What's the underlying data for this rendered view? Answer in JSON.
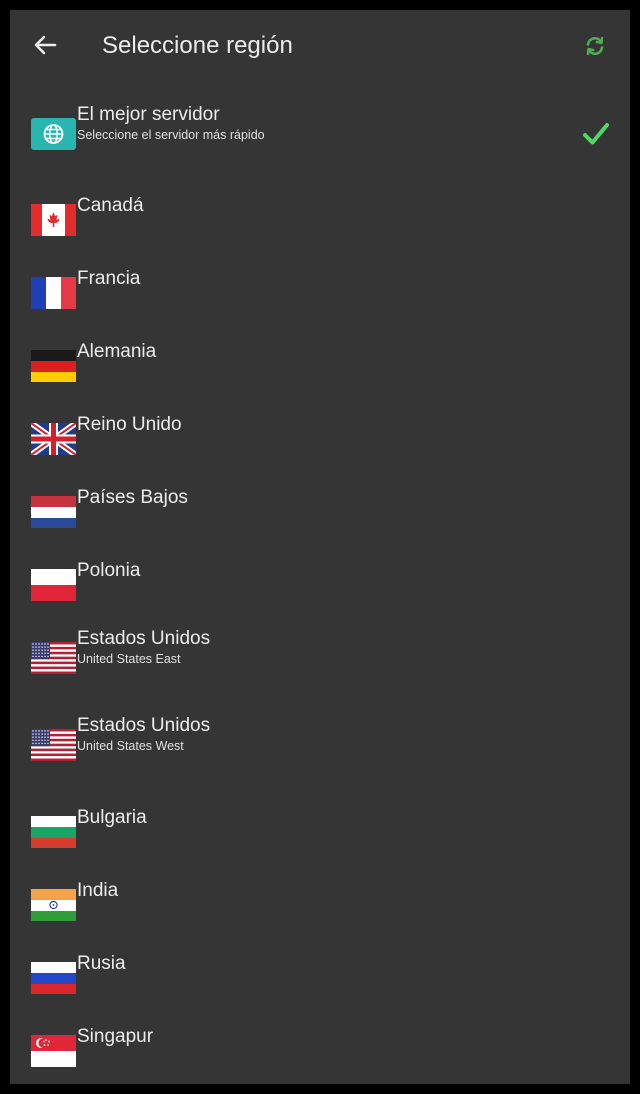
{
  "header": {
    "title": "Seleccione región",
    "back_icon": "arrow-left-icon",
    "refresh_icon": "refresh-icon",
    "refresh_color": "#4caf50"
  },
  "colors": {
    "background": "#353535",
    "text": "#ececec",
    "check": "#4cd964",
    "best_icon_bg": "#29b6b0"
  },
  "best": {
    "name": "El mejor servidor",
    "subtitle": "Seleccione el servidor más rápido",
    "icon": "globe-icon",
    "selected": true
  },
  "servers": [
    {
      "name": "Canadá",
      "flag": "canada-flag-icon"
    },
    {
      "name": "Francia",
      "flag": "france-flag-icon"
    },
    {
      "name": "Alemania",
      "flag": "germany-flag-icon"
    },
    {
      "name": "Reino Unido",
      "flag": "uk-flag-icon"
    },
    {
      "name": "Países Bajos",
      "flag": "netherlands-flag-icon"
    },
    {
      "name": "Polonia",
      "flag": "poland-flag-icon"
    },
    {
      "name": "Estados Unidos",
      "subtitle": "United States East",
      "flag": "usa-flag-icon"
    },
    {
      "name": "Estados Unidos",
      "subtitle": "United States West",
      "flag": "usa-flag-icon"
    },
    {
      "name": "Bulgaria",
      "flag": "bulgaria-flag-icon"
    },
    {
      "name": "India",
      "flag": "india-flag-icon"
    },
    {
      "name": "Rusia",
      "flag": "russia-flag-icon"
    },
    {
      "name": "Singapur",
      "flag": "singapore-flag-icon"
    }
  ]
}
